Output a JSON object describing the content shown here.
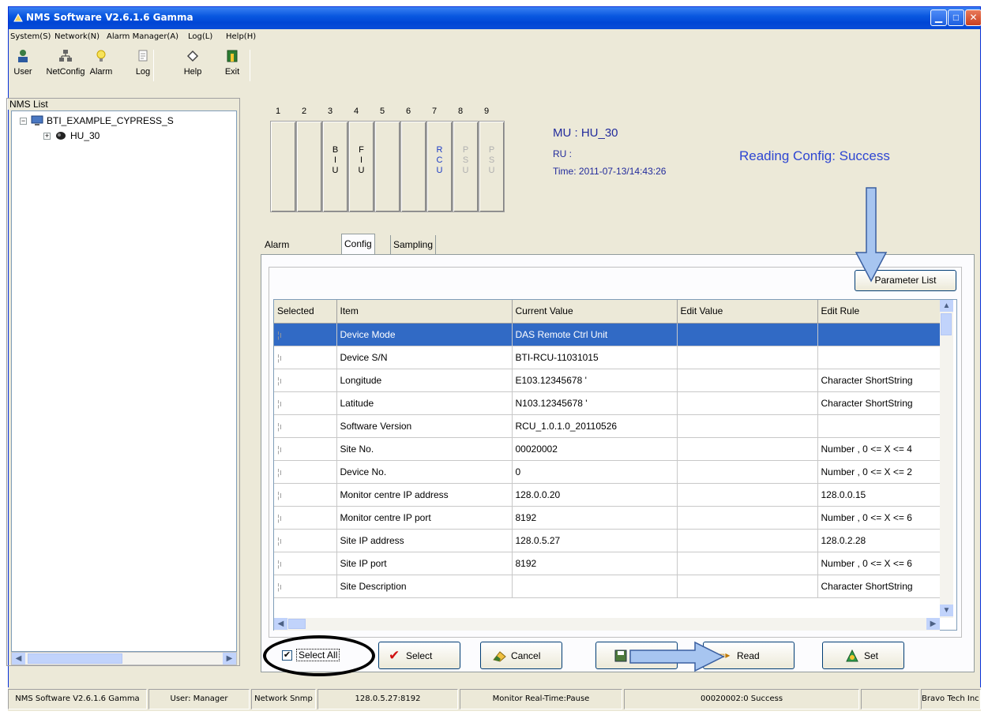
{
  "window": {
    "title": "NMS Software V2.6.1.6 Gamma"
  },
  "menu": [
    "System(S)",
    "Network(N)",
    "Alarm Manager(A)",
    "Log(L)",
    "Help(H)"
  ],
  "toolbar": {
    "user": "User",
    "netconfig": "NetConfig",
    "alarm": "Alarm",
    "log": "Log",
    "help": "Help",
    "exit": "Exit"
  },
  "nms_list": {
    "title": "NMS List",
    "root": "BTI_EXAMPLE_CYPRESS_S",
    "child": "HU_30"
  },
  "slots": {
    "numbers": [
      "1",
      "2",
      "3",
      "4",
      "5",
      "6",
      "7",
      "8",
      "9"
    ],
    "labels": [
      "",
      "",
      "B\nI\nU",
      "F\nI\nU",
      "",
      "",
      "R\nC\nU",
      "P\nS\nU",
      "P\nS\nU"
    ]
  },
  "unit_info": {
    "mu": "MU : HU_30",
    "ru": "RU :",
    "time": "Time: 2011-07-13/14:43:26",
    "status": "Reading Config: Success"
  },
  "tabs": [
    "Alarm Status",
    "Config",
    "Sampling"
  ],
  "param_list_button": "Parameter List",
  "grid": {
    "columns": [
      "Selected",
      "Item",
      "Current Value",
      "Edit Value",
      "Edit Rule"
    ],
    "rows": [
      [
        "Device Mode",
        "DAS Remote Ctrl Unit",
        "",
        ""
      ],
      [
        "Device S/N",
        "BTI-RCU-11031015",
        "",
        ""
      ],
      [
        "Longitude",
        "E103.12345678 '",
        "",
        "Character ShortString"
      ],
      [
        "Latitude",
        "N103.12345678 '",
        "",
        "Character ShortString"
      ],
      [
        "Software Version",
        "RCU_1.0.1.0_20110526",
        "",
        ""
      ],
      [
        "Site No.",
        "00020002",
        "",
        "Number , 0 <= X <= 4"
      ],
      [
        "Device No.",
        "0",
        "",
        "Number , 0 <= X <= 2"
      ],
      [
        "Monitor centre IP address",
        "128.0.0.20",
        "",
        "128.0.0.15"
      ],
      [
        "Monitor centre IP port",
        "8192",
        "",
        "Number , 0 <= X <= 6"
      ],
      [
        "Site IP address",
        "128.0.5.27",
        "",
        "128.0.2.28"
      ],
      [
        "Site IP port",
        "8192",
        "",
        "Number , 0 <= X <= 6"
      ],
      [
        "Site Description",
        "",
        "",
        "Character ShortString"
      ]
    ],
    "selected_row": 0,
    "row_marker": "¦ı"
  },
  "buttons": {
    "select_all": "Select All",
    "select": "Select",
    "cancel": "Cancel",
    "read": "Read",
    "set": "Set"
  },
  "status_bar": [
    "NMS Software V2.6.1.6 Gamma",
    "User: Manager",
    "Network Snmp",
    "128.0.5.27:8192",
    "Monitor Real-Time:Pause",
    "00020002:0 Success",
    "",
    "Bravo Tech Inc"
  ],
  "colors": {
    "selection": "#316ac5",
    "status_text": "#2e46d2",
    "annotation_arrow": "#a7c5f0"
  }
}
